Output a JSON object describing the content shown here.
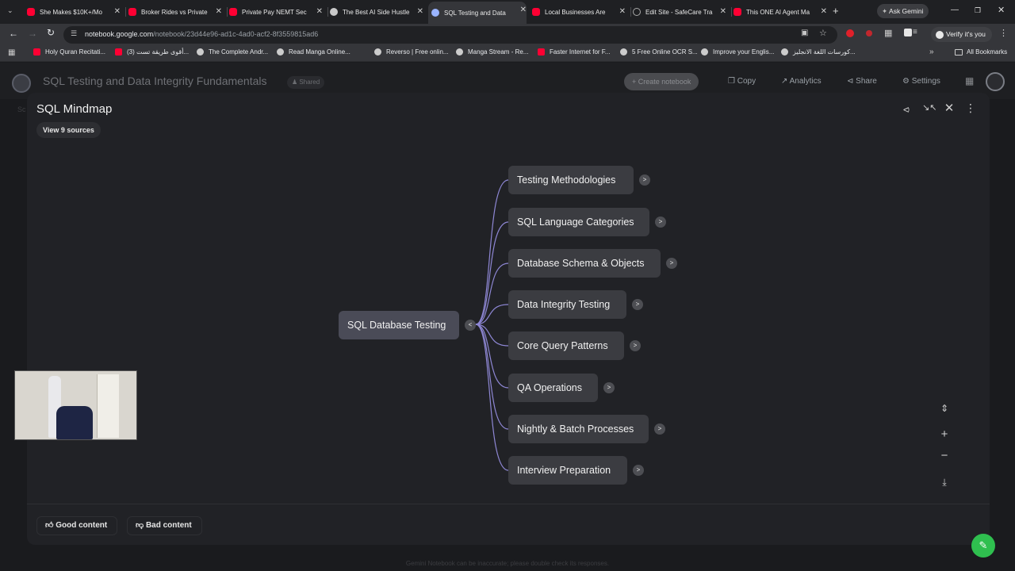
{
  "browser": {
    "tabs": [
      {
        "title": "She Makes $10K+/Mo",
        "icon": "youtube-icon"
      },
      {
        "title": "Broker Rides vs Private",
        "icon": "youtube-icon"
      },
      {
        "title": "Private Pay NEMT Sec",
        "icon": "youtube-icon"
      },
      {
        "title": "The Best AI Side Hustle",
        "icon": "document-icon"
      },
      {
        "title": "SQL Testing and Data",
        "icon": "notebooklm-icon",
        "active": true
      },
      {
        "title": "Local Businesses Are",
        "icon": "youtube-icon"
      },
      {
        "title": "Edit Site - SafeCare Tra",
        "icon": "edit-icon"
      },
      {
        "title": "This ONE AI Agent Ma",
        "icon": "youtube-icon"
      }
    ],
    "ask_gemini": "Ask Gemini",
    "url_host": "notebook.google.com",
    "url_path": "/notebook/23d44e96-ad1c-4ad0-acf2-8f3559815ad6",
    "verify": "Verify it's you",
    "bookmarks": [
      "Holy Quran Recitati...",
      "(3) أقوى طريقة تست...",
      "The Complete Andr...",
      "Read Manga Online...",
      "Reverso | Free onlin...",
      "Manga Stream - Re...",
      "Faster Internet for F...",
      "5 Free Online OCR S...",
      "Improve your Englis...",
      "كورسات اللغة الانجليز..."
    ],
    "all_bookmarks": "All Bookmarks"
  },
  "appbar": {
    "notebook_title": "SQL Testing and Data Integrity Fundamentals",
    "shared": "Shared",
    "create_notebook": "Create notebook",
    "copy": "Copy",
    "analytics": "Analytics",
    "share": "Share",
    "settings": "Settings"
  },
  "mindmap": {
    "title": "SQL Mindmap",
    "view_sources": "View 9 sources",
    "root": "SQL Database Testing",
    "root_toggle": "<",
    "branches": [
      "Testing Methodologies",
      "SQL Language Categories",
      "Database Schema & Objects",
      "Data Integrity Testing",
      "Core Query Patterns",
      "QA Operations",
      "Nightly & Batch Processes",
      "Interview Preparation"
    ],
    "expand_label": ">",
    "good_content": "Good content",
    "bad_content": "Bad content"
  },
  "disclaimer": "Gemini Notebook can be inaccurate; please double check its responses."
}
